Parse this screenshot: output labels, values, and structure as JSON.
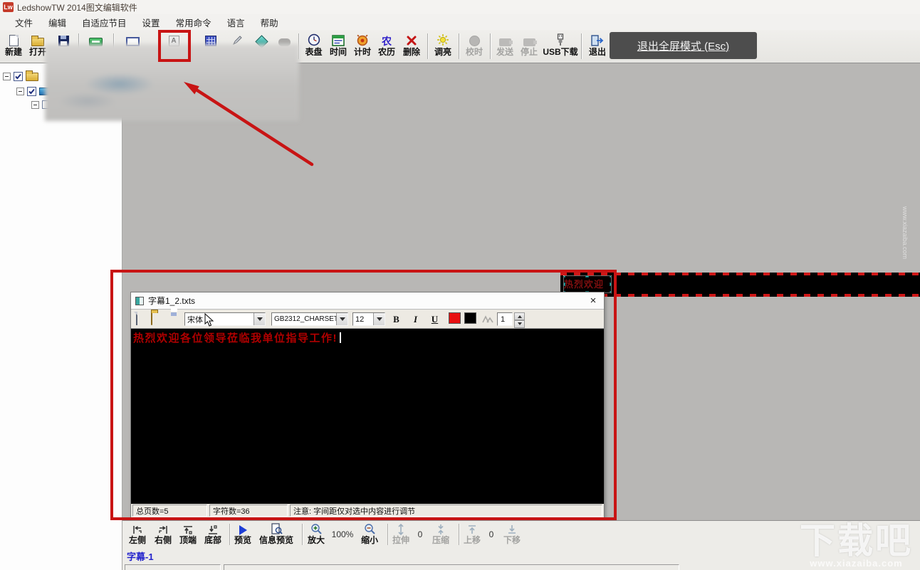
{
  "window": {
    "title": "LedshowTW 2014图文编辑软件",
    "logo_text": "Lw"
  },
  "menu_bar": {
    "items": [
      "文件",
      "编辑",
      "自适应节目",
      "设置",
      "常用命令",
      "语言",
      "帮助"
    ]
  },
  "toolbar": {
    "new_label": "新建",
    "open_label": "打开",
    "subtitle_icon_glyph": "A",
    "right_items": [
      {
        "label": "表盘"
      },
      {
        "label": "时间"
      },
      {
        "label": "计时"
      },
      {
        "label": "农历",
        "glyph": "农"
      },
      {
        "label": "删除"
      },
      {
        "label": "调亮"
      },
      {
        "label": "校时"
      },
      {
        "label": "发送"
      },
      {
        "label": "停止"
      },
      {
        "label": "USB下载"
      },
      {
        "label": "退出"
      }
    ]
  },
  "fullscreen_notice": {
    "label": "退出全屏模式 (Esc)"
  },
  "editor_dialog": {
    "title": "字幕1_2.txts",
    "close_glyph": "×",
    "font_name": "宋体",
    "charset": "GB2312_CHARSET",
    "font_size": "12",
    "bold_label": "B",
    "italic_label": "I",
    "underline_label": "U",
    "spacing_value": "1",
    "content_text": "热烈欢迎各位领导莅临我单位指导工作!",
    "status": {
      "total_pages": "总页数=5",
      "char_count": "字符数=36",
      "note": "注意: 字间距仅对选中内容进行调节"
    }
  },
  "led_strip": {
    "selected_text": "热烈欢迎"
  },
  "bottom_toolbar": {
    "align_left": "左侧",
    "align_right": "右侧",
    "align_top": "顶端",
    "align_bottom": "底部",
    "preview_label": "预览",
    "info_preview_label": "信息预览",
    "zoom_in_label": "放大",
    "zoom_level": "100%",
    "zoom_out_label": "缩小",
    "stretch_label": "拉伸",
    "stretch_value": "0",
    "compress_label": "压缩",
    "move_up_label": "上移",
    "move_value": "0",
    "move_down_label": "下移"
  },
  "status_bar": {
    "current_item": "字幕-1"
  },
  "watermark": {
    "brand": "下载吧",
    "site": "www.xiazaiba.com"
  },
  "colors": {
    "annotation_red": "#c81414",
    "workspace_gray": "#b8b7b5",
    "led_text_red": "#b00000",
    "selection_teal": "#1fb3b3"
  }
}
